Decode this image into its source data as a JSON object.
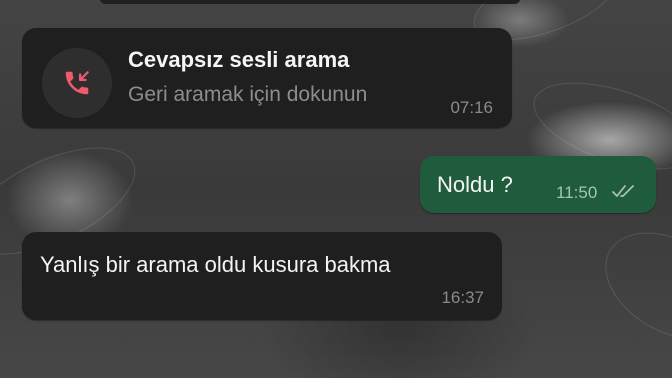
{
  "chat": {
    "missed_call": {
      "title": "Cevapsız sesli arama",
      "subtitle": "Geri aramak için dokunun",
      "time": "07:16",
      "icon": "missed-call-icon",
      "icon_color": "#f05a6e"
    },
    "outgoing": {
      "text": "Noldu ?",
      "time": "11:50",
      "status_icon": "double-check-icon",
      "bubble_color": "#1f5c3c"
    },
    "incoming": {
      "text": "Yanlış bir arama oldu kusura bakma",
      "time": "16:37",
      "bubble_color": "#1f1f1f"
    }
  }
}
